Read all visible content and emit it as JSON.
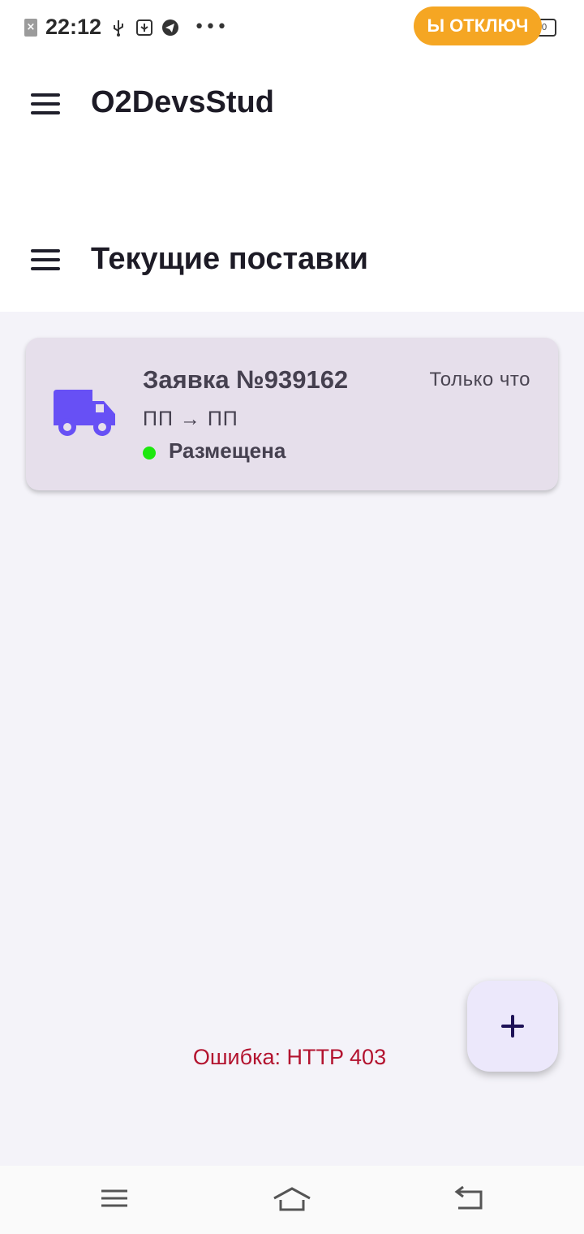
{
  "status_bar": {
    "time": "22:12",
    "vpn_label": "Ы ОТКЛЮЧ",
    "battery": "100",
    "icons": [
      "sim-error-icon",
      "usb-icon",
      "usb-debug-icon",
      "telegram-icon",
      "more-dots-icon"
    ]
  },
  "app_bar": {
    "title": "O2DevsStud"
  },
  "section_bar": {
    "title": "Текущие поставки"
  },
  "request_card": {
    "title": "Заявка №939162",
    "time": "Только что",
    "route": "ПП → ПП",
    "status": "Размещена",
    "status_color": "#1de80f",
    "icon": "truck-icon",
    "icon_color": "#6750f5"
  },
  "error_message": "Ошибка: HTTP 403",
  "fab": {
    "icon": "plus-icon"
  },
  "colors": {
    "content_bg": "#f4f3f9",
    "card_bg": "#e6dfeb",
    "error": "#b3132f",
    "vpn_pill": "#f5a623",
    "fab_bg": "#ece8fb"
  }
}
